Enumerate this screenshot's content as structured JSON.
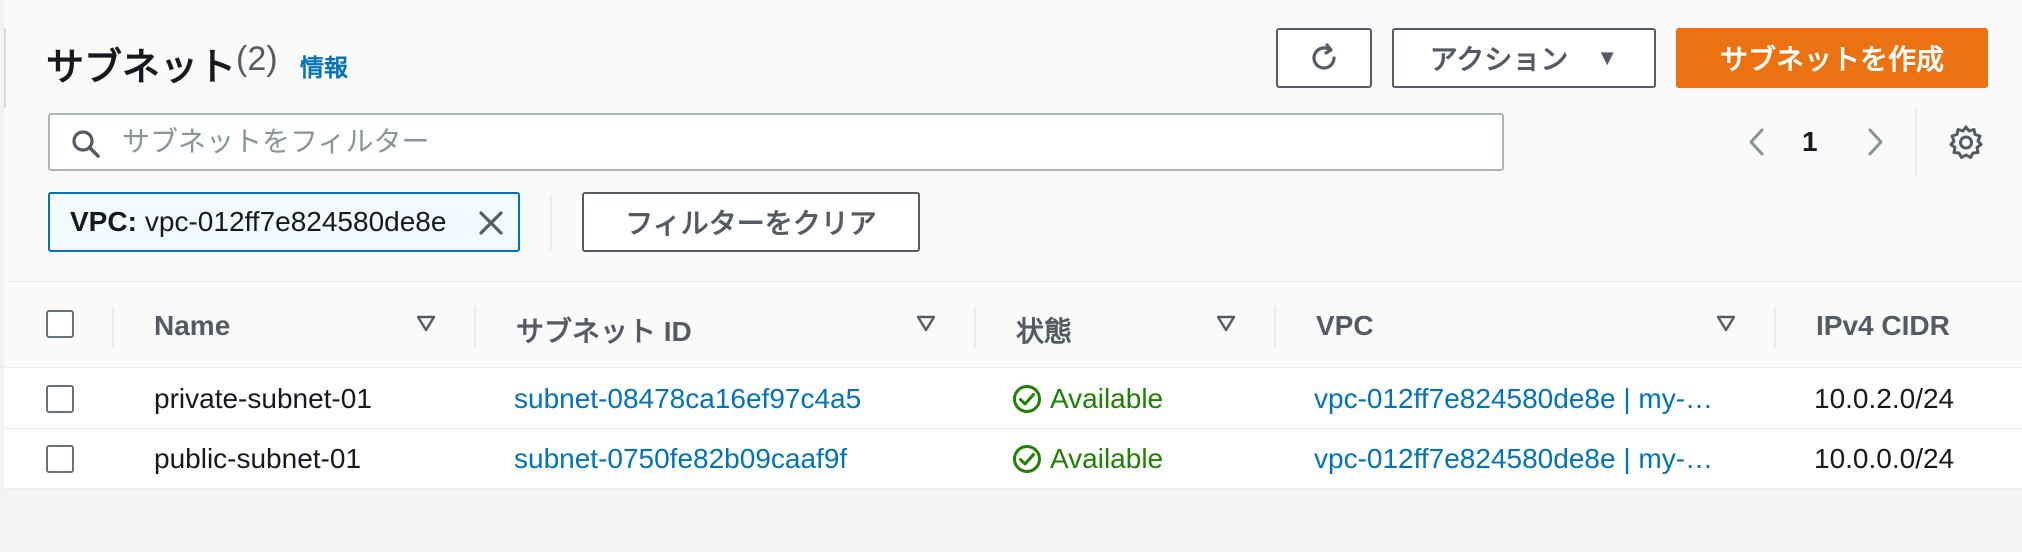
{
  "header": {
    "title": "サブネット",
    "count": "(2)",
    "info_link": "情報",
    "actions_label": "アクション",
    "create_label": "サブネットを作成"
  },
  "search": {
    "placeholder": "サブネットをフィルター",
    "value": ""
  },
  "pagination": {
    "current_page": "1"
  },
  "filter_token": {
    "key": "VPC:",
    "value": "vpc-012ff7e824580de8e"
  },
  "clear_filters_label": "フィルターをクリア",
  "table": {
    "columns": [
      "Name",
      "サブネット ID",
      "状態",
      "VPC",
      "IPv4 CIDR"
    ],
    "rows": [
      {
        "name": "private-subnet-01",
        "subnet_id": "subnet-08478ca16ef97c4a5",
        "state": "Available",
        "vpc": "vpc-012ff7e824580de8e | my-…",
        "cidr": "10.0.2.0/24"
      },
      {
        "name": "public-subnet-01",
        "subnet_id": "subnet-0750fe82b09caaf9f",
        "state": "Available",
        "vpc": "vpc-012ff7e824580de8e | my-…",
        "cidr": "10.0.0.0/24"
      }
    ]
  },
  "colors": {
    "primary_button": "#ec7211",
    "link": "#0073bb",
    "status_available": "#1d8102",
    "token_border": "#0073bb",
    "token_background": "#f1faff"
  },
  "icons": {
    "refresh": "refresh-icon",
    "search": "search-icon",
    "settings": "gear-icon",
    "close": "close-icon",
    "status": "check-circle-icon",
    "sort": "sort-triangle-icon",
    "prev": "chevron-left-icon",
    "next": "chevron-right-icon"
  }
}
